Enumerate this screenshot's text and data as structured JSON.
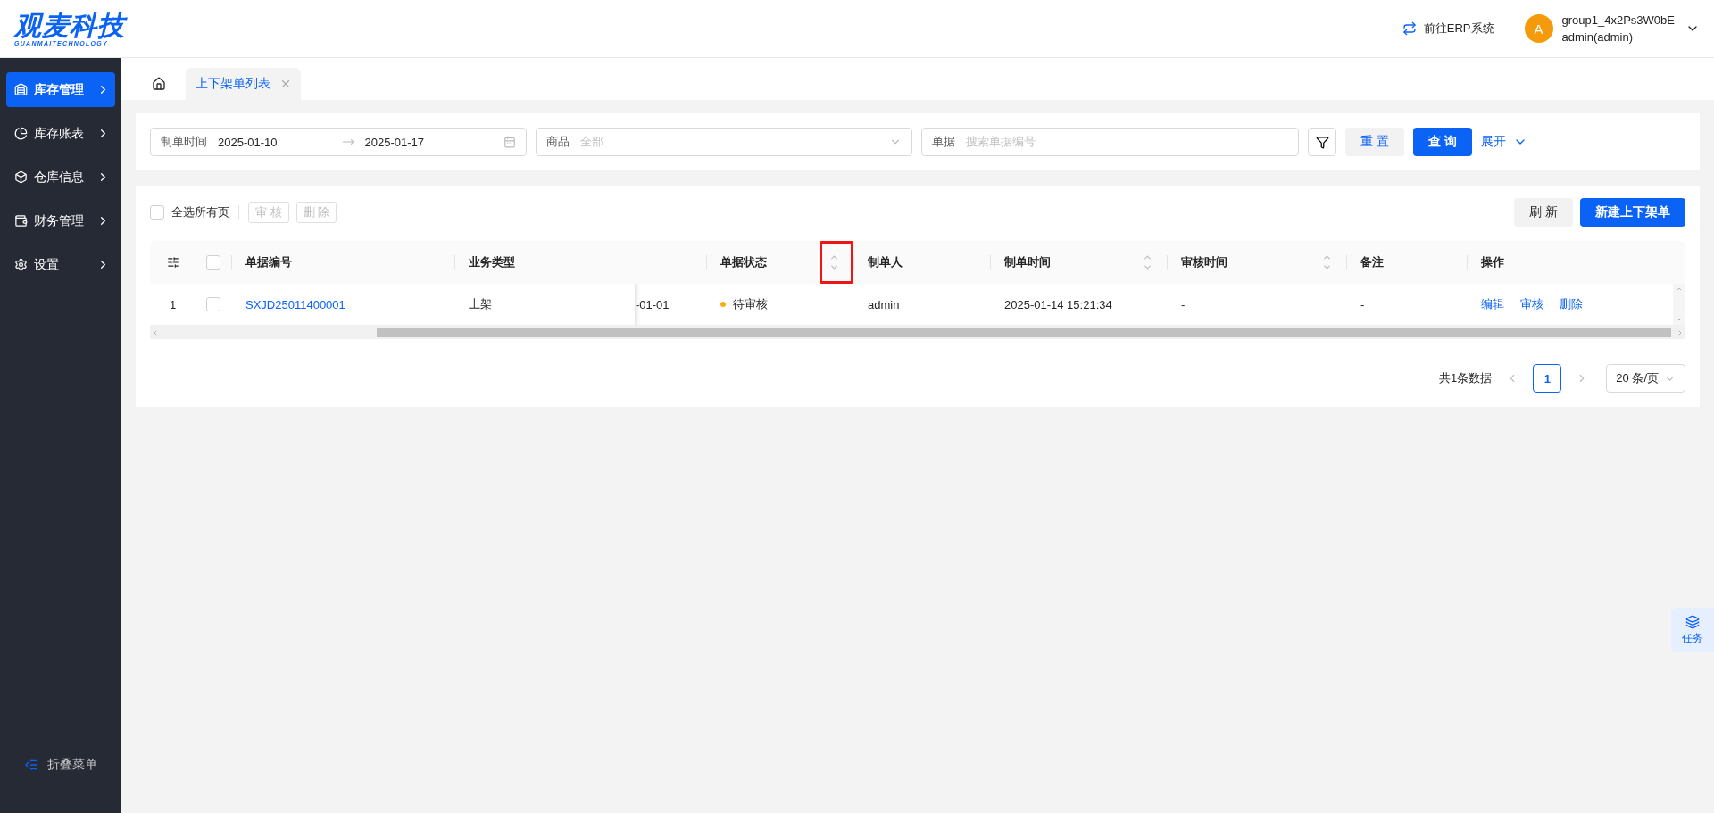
{
  "header": {
    "logo": {
      "title": "观麦科技",
      "subtitle": "GUANMAITECHNOLOGY"
    },
    "erp_link": "前往ERP系统",
    "user": {
      "avatar": "A",
      "name": "group1_4x2Ps3W0bE",
      "role": "admin(admin)"
    }
  },
  "sidebar": {
    "items": [
      {
        "label": "库存管理",
        "selected": true
      },
      {
        "label": "库存账表",
        "selected": false
      },
      {
        "label": "仓库信息",
        "selected": false
      },
      {
        "label": "财务管理",
        "selected": false
      },
      {
        "label": "设置",
        "selected": false
      }
    ],
    "collapse": "折叠菜单"
  },
  "tabs": [
    {
      "label": "上下架单列表",
      "selected": true
    }
  ],
  "filters": {
    "date_range": {
      "label": "制单时间",
      "start": "2025-01-10",
      "end": "2025-01-17"
    },
    "product": {
      "label": "商品",
      "placeholder": "全部"
    },
    "document": {
      "label": "单据",
      "placeholder": "搜索单据编号"
    },
    "reset": "重 置",
    "search": "查 询",
    "expand": "展开"
  },
  "toolbar": {
    "select_all": {
      "label": "全选所有页",
      "checked": false
    },
    "batch_buttons": [
      {
        "label": "审 核",
        "disabled": true
      },
      {
        "label": "删 除",
        "disabled": true
      }
    ],
    "refresh": "刷 新",
    "create": "新建上下架单"
  },
  "table": {
    "columns": [
      {
        "kind": "settings"
      },
      {
        "kind": "checkbox",
        "checked": false
      },
      {
        "kind": "text",
        "label": "单据编号"
      },
      {
        "kind": "text",
        "label": "业务类型"
      },
      {
        "kind": "blank"
      },
      {
        "kind": "text",
        "label": "单据状态",
        "sortable": true,
        "highlighted": true
      },
      {
        "kind": "text",
        "label": "制单人"
      },
      {
        "kind": "text",
        "label": "制单时间",
        "sortable": true
      },
      {
        "kind": "text",
        "label": "审核时间",
        "sortable": true
      },
      {
        "kind": "text",
        "label": "备注"
      },
      {
        "kind": "text",
        "label": "操作"
      }
    ],
    "rows": [
      {
        "cells": [
          {
            "kind": "index",
            "text": "1"
          },
          {
            "kind": "checkbox",
            "checked": false
          },
          {
            "kind": "link",
            "text": "SXJD25011400001"
          },
          {
            "kind": "text",
            "text": "上架"
          },
          {
            "kind": "clipped",
            "text": "-01-01"
          },
          {
            "kind": "status",
            "text": "待审核",
            "color": "#faad14"
          },
          {
            "kind": "text",
            "text": "admin"
          },
          {
            "kind": "text",
            "text": "2025-01-14 15:21:34"
          },
          {
            "kind": "text",
            "text": "-"
          },
          {
            "kind": "text",
            "text": "-"
          },
          {
            "kind": "actions",
            "actions": [
              "编辑",
              "审核",
              "删除"
            ]
          }
        ]
      }
    ]
  },
  "pagination": {
    "total": "共1条数据",
    "pages": [
      {
        "label": "1",
        "selected": true
      }
    ],
    "page_size": "20 条/页"
  },
  "task_button": "任务"
}
